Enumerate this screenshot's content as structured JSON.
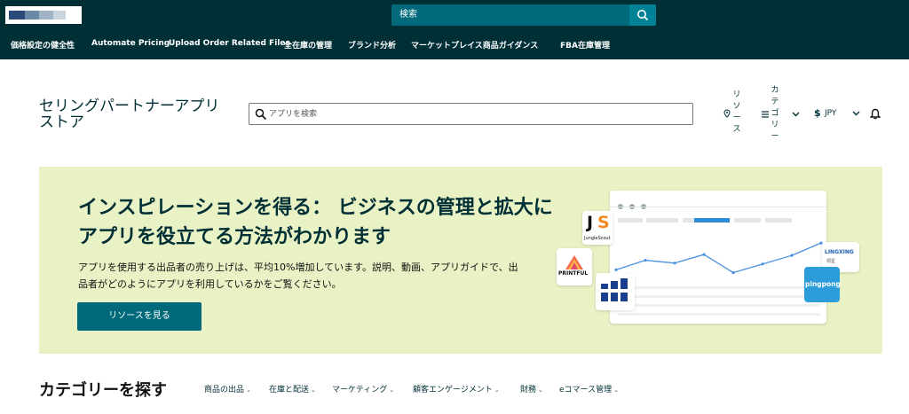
{
  "topbar": {
    "search_placeholder": "検索"
  },
  "nav": {
    "items": [
      "価格設定の健全性",
      "Automate Pricing",
      "Upload Order Related Files",
      "全在庫の管理",
      "ブランド分析",
      "マーケットプレイス商品ガイダンス",
      "FBA在庫管理"
    ]
  },
  "store": {
    "title": "セリングパートナーアプリストア",
    "search_placeholder": "アプリを検索",
    "resources": "リソース",
    "categories": "カテゴリー",
    "currency": "JPY"
  },
  "banner": {
    "heading": "インスピレーションを得る： ビジネスの管理と拡大にアプリを役立てる方法がわかります",
    "body": "アプリを使用する出品者の売り上げは、平均10%増加しています。説明、動画、アプリガイドで、出品者がどのようにアプリを利用しているかをご覧ください。",
    "button": "リソースを見る",
    "logos": {
      "jungle": "JungleScout",
      "printful": "PRINTFUL",
      "lingxing": "LINGXING",
      "lingxing_sub": "领星",
      "pingpong": "pingpong"
    },
    "mock_chart": [
      42,
      32,
      35,
      26,
      45,
      36,
      27,
      14
    ]
  },
  "categories": {
    "title": "カテゴリーを探す",
    "items": [
      "商品の出品",
      "在庫と配送",
      "マーケティング",
      "顧客エンゲージメント",
      "財務",
      "eコマース管理"
    ]
  },
  "colors": {
    "topbar": "#002f36",
    "accent": "#00697a",
    "banner": "#e8f2c4",
    "chart_line": "#4a90e2"
  }
}
